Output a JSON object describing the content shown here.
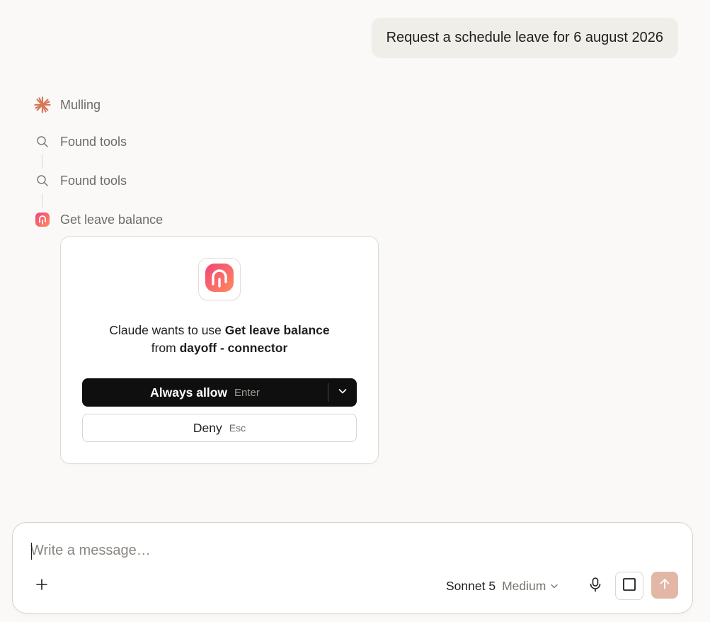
{
  "user_message": "Request a schedule leave for 6 august 2026",
  "steps": [
    {
      "label": "Mulling",
      "icon": "claude-spark-icon"
    },
    {
      "label": "Found tools",
      "icon": "search-icon"
    },
    {
      "label": "Found tools",
      "icon": "search-icon"
    },
    {
      "label": "Get leave balance",
      "icon": "dayoff-app-icon"
    }
  ],
  "permission": {
    "text_prefix": "Claude wants to use ",
    "tool_name": "Get leave balance",
    "text_middle": " from ",
    "connector_name": "dayoff - connector",
    "allow_label": "Always allow",
    "allow_shortcut": "Enter",
    "deny_label": "Deny",
    "deny_shortcut": "Esc"
  },
  "composer": {
    "placeholder": "Write a message…",
    "model_name": "Sonnet 5",
    "model_effort": "Medium"
  },
  "colors": {
    "claude_accent": "#d97757",
    "dayoff_gradient_start": "#f2457a",
    "dayoff_gradient_end": "#ff8a5c",
    "send_disabled": "#e2b7a6",
    "primary_button": "#0f0f0f"
  }
}
